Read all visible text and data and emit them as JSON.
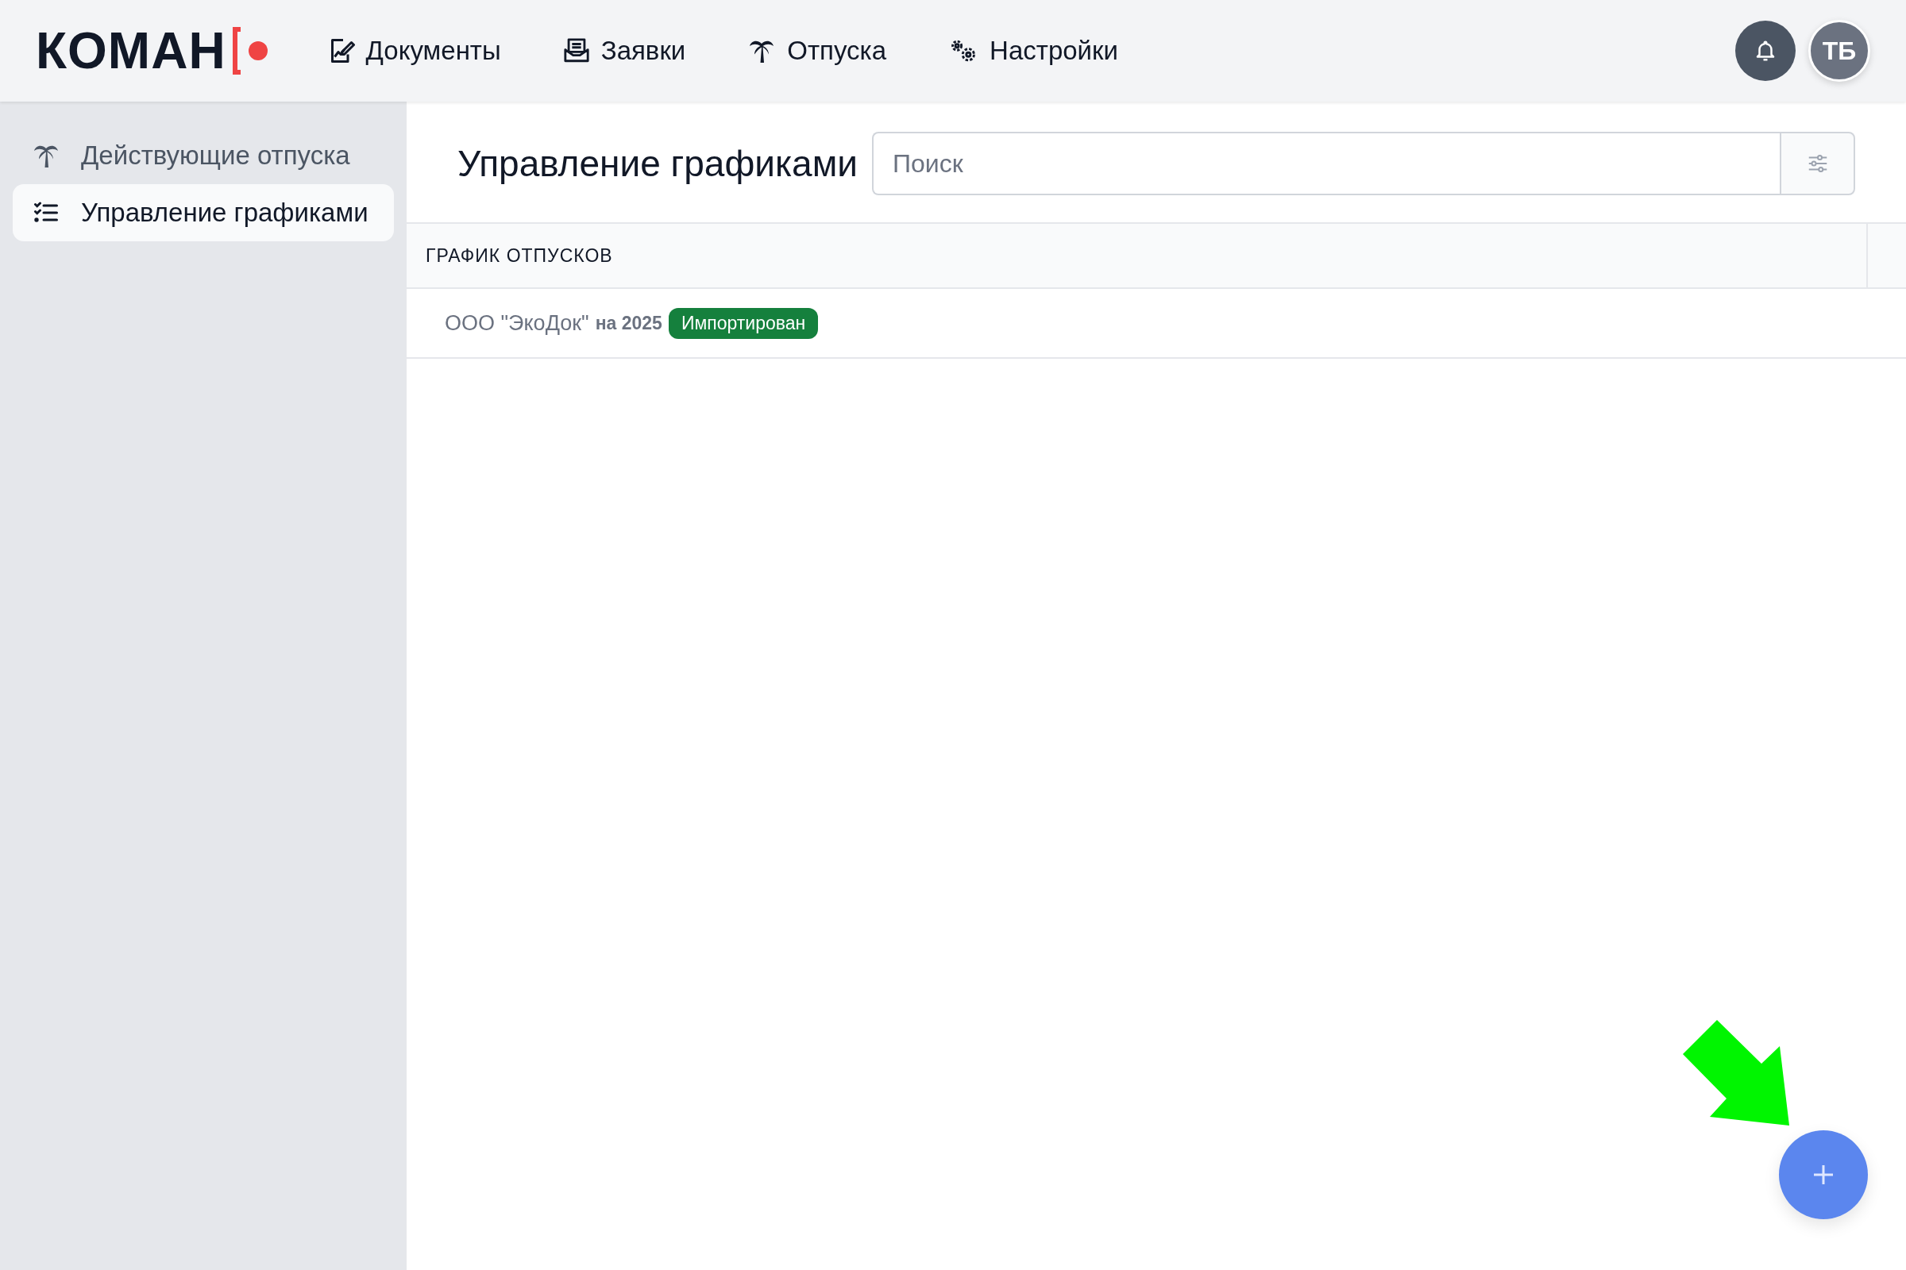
{
  "header": {
    "logo": "КОМАН",
    "nav": [
      {
        "label": "Документы"
      },
      {
        "label": "Заявки"
      },
      {
        "label": "Отпуска"
      },
      {
        "label": "Настройки"
      }
    ],
    "avatar": "ТБ"
  },
  "sidebar": {
    "items": [
      {
        "label": "Действующие отпуска",
        "selected": false
      },
      {
        "label": "Управление графиками",
        "selected": true
      }
    ]
  },
  "main": {
    "title": "Управление графиками",
    "search": {
      "placeholder": "Поиск"
    },
    "table": {
      "columns": [
        "ГРАФИК ОТПУСКОВ"
      ],
      "rows": [
        {
          "name": "ООО \"ЭкоДок\"",
          "year": "на 2025",
          "status": "Импортирован"
        }
      ]
    }
  }
}
